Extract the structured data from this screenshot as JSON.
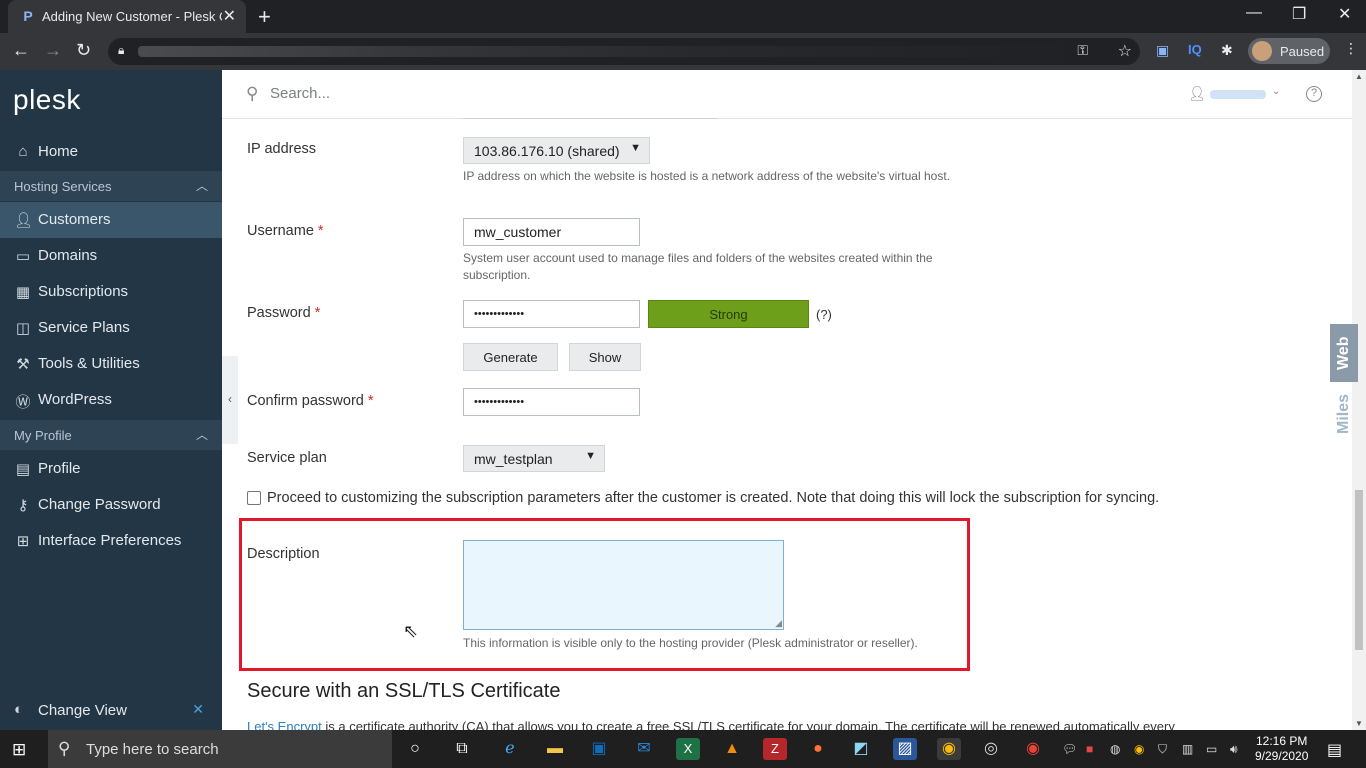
{
  "browser": {
    "tab_title": "Adding New Customer - Plesk O",
    "tab_favicon": "P",
    "paused_label": "Paused"
  },
  "sidebar": {
    "logo": "plesk",
    "home": "Home",
    "hosting_section": "Hosting Services",
    "items": [
      {
        "label": "Customers",
        "icon": "user-icon"
      },
      {
        "label": "Domains",
        "icon": "monitor-icon"
      },
      {
        "label": "Subscriptions",
        "icon": "grid-icon"
      },
      {
        "label": "Service Plans",
        "icon": "book-icon"
      },
      {
        "label": "Tools & Utilities",
        "icon": "tools-icon"
      },
      {
        "label": "WordPress",
        "icon": "wordpress-icon"
      }
    ],
    "profile_section": "My Profile",
    "profile_items": [
      {
        "label": "Profile"
      },
      {
        "label": "Change Password"
      },
      {
        "label": "Interface Preferences"
      }
    ],
    "change_view": "Change View"
  },
  "header": {
    "search_placeholder": "Search..."
  },
  "form": {
    "ip_label": "IP address",
    "ip_value": "103.86.176.10 (shared)",
    "ip_hint": "IP address on which the website is hosted is a network address of the website's virtual host.",
    "username_label": "Username",
    "username_value": "mw_customer",
    "username_hint": "System user account used to manage files and folders of the websites created within the subscription.",
    "password_label": "Password",
    "password_value": "•••••••••••••",
    "strength": "Strong",
    "strength_help": "(?)",
    "generate_label": "Generate",
    "show_label": "Show",
    "confirm_label": "Confirm password",
    "confirm_value": "•••••••••••••",
    "plan_label": "Service plan",
    "plan_value": "mw_testplan",
    "proceed_label": "Proceed to customizing the subscription parameters after the customer is created. Note that doing this will lock the subscription for syncing.",
    "description_label": "Description",
    "description_hint": "This information is visible only to the hosting provider (Plesk administrator or reseller).",
    "required_mark": "*"
  },
  "ssl": {
    "heading": "Secure with an SSL/TLS Certificate",
    "link": "Let's Encrypt",
    "text": " is a certificate authority (CA) that allows you to create a free SSL/TLS certificate for your domain. The certificate will be renewed automatically every"
  },
  "watermark": {
    "top": "Web",
    "bottom": "Miles"
  },
  "taskbar": {
    "search_placeholder": "Type here to search",
    "time": "12:16 PM",
    "date": "9/29/2020"
  }
}
